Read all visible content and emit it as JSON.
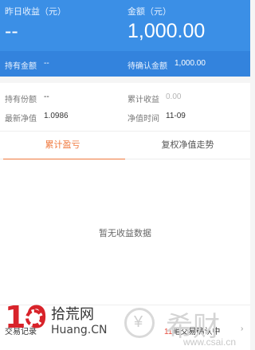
{
  "hero": {
    "yesterday_label": "昨日收益（元）",
    "yesterday_value": "--",
    "amount_label": "金额（元）",
    "amount_value": "1,000.00",
    "holding_label": "持有金额",
    "holding_value": "--",
    "pending_label": "待确认金额",
    "pending_value": "1,000.00"
  },
  "info": {
    "shares_label": "持有份额",
    "shares_value": "--",
    "cumulative_label": "累计收益",
    "cumulative_value": "0.00",
    "nav_label": "最新净值",
    "nav_value": "1.0986",
    "nav_time_label": "净值时间",
    "nav_time_value": "11-09"
  },
  "tabs": {
    "tab1": "累计盈亏",
    "tab2": "复权净值走势"
  },
  "content": {
    "empty_text": "暂无收益数据"
  },
  "footer": {
    "left_text": "交易记录",
    "right_count": "11",
    "right_text": "笔交易确认中",
    "arrow": "›"
  },
  "watermarks": {
    "left_big": "10",
    "left_zh": "拾荒网",
    "left_en": "Huang.CN",
    "right_text": "希财",
    "right_url": "www.csai.cn"
  },
  "colors": {
    "primary": "#3b8fe6",
    "accent": "#f0783c"
  }
}
